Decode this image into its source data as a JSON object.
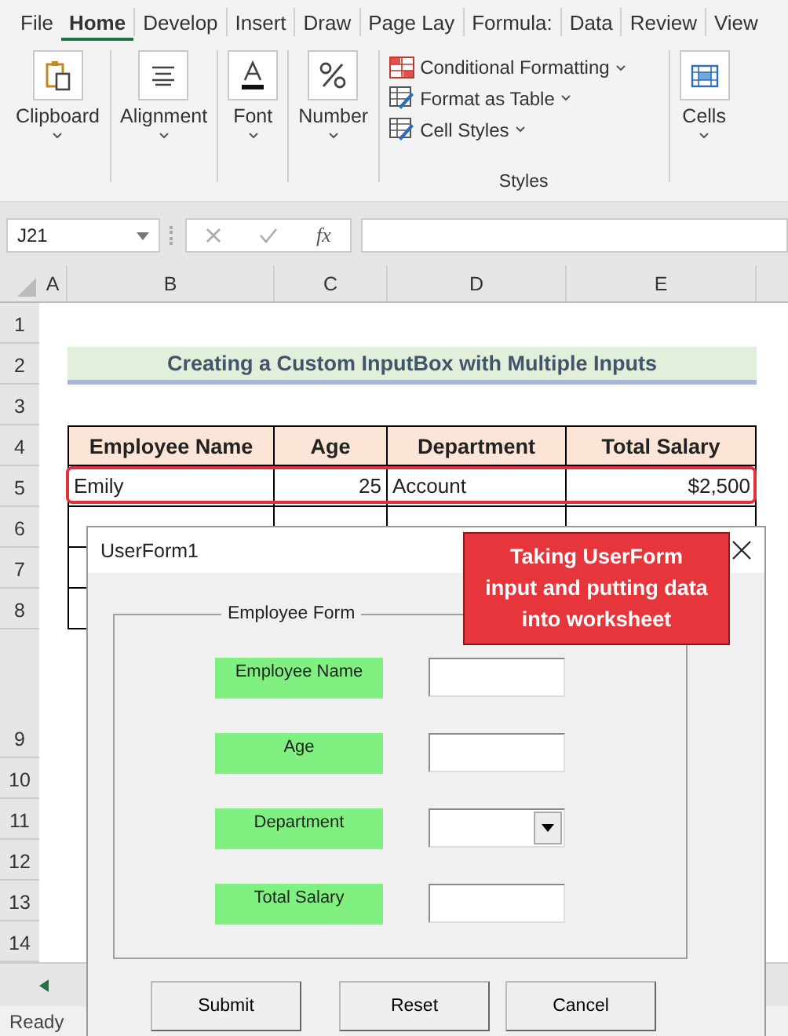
{
  "ribbon_tabs": [
    {
      "label": "File",
      "selected": false
    },
    {
      "label": "Home",
      "selected": true
    },
    {
      "label": "Develop",
      "selected": false
    },
    {
      "label": "Insert",
      "selected": false
    },
    {
      "label": "Draw",
      "selected": false
    },
    {
      "label": "Page Lay",
      "selected": false
    },
    {
      "label": "Formula:",
      "selected": false
    },
    {
      "label": "Data",
      "selected": false
    },
    {
      "label": "Review",
      "selected": false
    },
    {
      "label": "View",
      "selected": false
    }
  ],
  "ribbon_groups": [
    {
      "kind": "clipboard",
      "label": "Clipboard"
    },
    {
      "kind": "alignment",
      "label": "Alignment"
    },
    {
      "kind": "font",
      "label": "Font"
    },
    {
      "kind": "number",
      "label": "Number"
    },
    {
      "kind": "styles",
      "label": "Styles",
      "items": [
        "Conditional Formatting",
        "Format as Table",
        "Cell Styles"
      ]
    },
    {
      "kind": "cells",
      "label": "Cells"
    }
  ],
  "formula_bar": {
    "name_box": "J21",
    "function_label": "fx"
  },
  "columns": [
    "A",
    "B",
    "C",
    "D",
    "E"
  ],
  "rows": [
    {
      "number": "1",
      "kind": "empty"
    },
    {
      "number": "2",
      "kind": "title",
      "text": "Creating a Custom InputBox with Multiple Inputs"
    },
    {
      "number": "3",
      "kind": "empty"
    },
    {
      "number": "4",
      "kind": "header",
      "cells": [
        "Employee Name",
        "Age",
        "Department",
        "Total Salary"
      ]
    },
    {
      "number": "5",
      "kind": "data",
      "highlighted": true,
      "cells": [
        "Emily",
        "25",
        "Account",
        "$2,500"
      ]
    },
    {
      "number": "6",
      "kind": "blank_table"
    },
    {
      "number": "7",
      "kind": "blank_table"
    },
    {
      "number": "8",
      "kind": "blank_table"
    },
    {
      "number": "9",
      "kind": "tall"
    },
    {
      "number": "10",
      "kind": "empty"
    },
    {
      "number": "11",
      "kind": "empty"
    },
    {
      "number": "12",
      "kind": "empty"
    },
    {
      "number": "13",
      "kind": "empty"
    },
    {
      "number": "14",
      "kind": "empty"
    }
  ],
  "dialog": {
    "title": "UserForm1",
    "frame_label": "Employee Form",
    "fields": [
      {
        "label": "Employee Name",
        "kind": "text"
      },
      {
        "label": "Age",
        "kind": "text"
      },
      {
        "label": "Department",
        "kind": "dropdown"
      },
      {
        "label": "Total Salary",
        "kind": "text"
      }
    ],
    "buttons": [
      "Submit",
      "Reset",
      "Cancel"
    ]
  },
  "callout": "Taking UserForm input and putting data into worksheet",
  "status_bar": "Ready"
}
